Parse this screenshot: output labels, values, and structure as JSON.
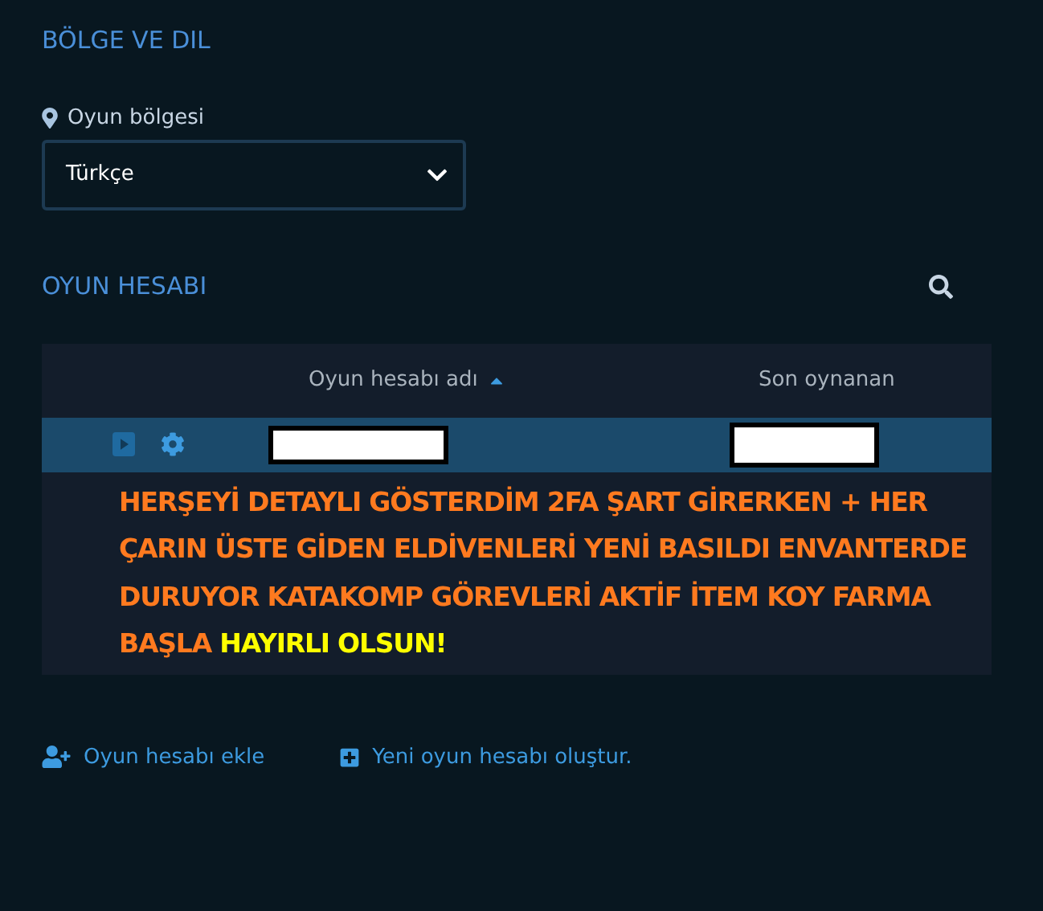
{
  "region_section": {
    "title": "BÖLGE VE DIL",
    "field_label": "Oyun bölgesi",
    "select_value": "Türkçe"
  },
  "account_section": {
    "title": "OYUN HESABI",
    "table": {
      "columns": [
        {
          "label": "Oyun hesabı adı",
          "sorted_ascending": true
        },
        {
          "label": "Son oynanan",
          "sorted_ascending": false
        }
      ],
      "rows": [
        {
          "selected": true
        }
      ]
    },
    "annotation": {
      "text": "HERŞEYİ DETAYLI GÖSTERDİM 2FA ŞART GİRERKEN + HER ÇARIN ÜSTE GİDEN ELDİVENLERİ YENİ BASILDI ENVANTERDE DURUYOR KATAKOMP GÖREVLERİ AKTİF İTEM KOY FARMA BAŞLA",
      "highlight": "HAYIRLI OLSUN!"
    }
  },
  "links": [
    {
      "kind": "add",
      "label": "Oyun hesabı ekle"
    },
    {
      "kind": "create",
      "label": "Yeni oyun hesabı oluştur."
    }
  ]
}
